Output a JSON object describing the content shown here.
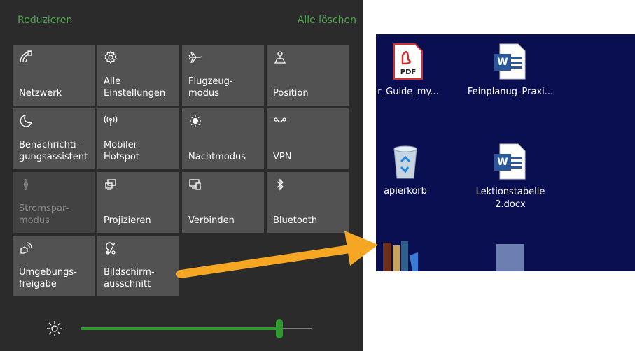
{
  "action_center": {
    "collapse_label": "Reduzieren",
    "clear_all_label": "Alle löschen",
    "tiles": [
      {
        "label": "Netzwerk",
        "icon": "network-icon",
        "active": true
      },
      {
        "label": "Alle\nEinstellungen",
        "icon": "gear-icon",
        "active": true
      },
      {
        "label": "Flugzeug-\nmodus",
        "icon": "airplane-icon",
        "active": true
      },
      {
        "label": "Position",
        "icon": "location-icon",
        "active": true
      },
      {
        "label": "Benachrichti-\ngungsassistent",
        "icon": "moon-icon",
        "active": true
      },
      {
        "label": "Mobiler\nHotspot",
        "icon": "hotspot-icon",
        "active": true
      },
      {
        "label": "Nachtmodus",
        "icon": "night-light-icon",
        "active": true
      },
      {
        "label": "VPN",
        "icon": "vpn-icon",
        "active": true
      },
      {
        "label": "Stromspar-\nmodus",
        "icon": "battery-saver-icon",
        "active": false
      },
      {
        "label": "Projizieren",
        "icon": "project-icon",
        "active": true
      },
      {
        "label": "Verbinden",
        "icon": "connect-icon",
        "active": true
      },
      {
        "label": "Bluetooth",
        "icon": "bluetooth-icon",
        "active": true
      },
      {
        "label": "Umgebungs-\nfreigabe",
        "icon": "nearby-sharing-icon",
        "active": true
      },
      {
        "label": "Bildschirm-\nausschnitt",
        "icon": "snip-icon",
        "active": true
      }
    ],
    "brightness": {
      "icon": "brightness-icon",
      "level": 0.86
    }
  },
  "desktop": {
    "icons": [
      {
        "name": "r_Guide_my...",
        "icon": "pdf-file-icon"
      },
      {
        "name": "Feinplanug_Praxi...",
        "icon": "word-file-icon"
      },
      {
        "name": "apierkorb",
        "icon": "recycle-bin-icon"
      },
      {
        "name": "Lektionstabelle\n2.docx",
        "icon": "word-file-icon"
      },
      {
        "name": "",
        "icon": "calibre-icon"
      },
      {
        "name": "",
        "icon": "blank-file-icon"
      }
    ],
    "pdf_badge": "PDF",
    "word_badge": "W"
  },
  "colors": {
    "panel_bg": "#2b2b2b",
    "tile_bg": "#525252",
    "tile_off_bg": "#424242",
    "accent_green": "#4ea64e",
    "desktop_bg": "#0a0f52",
    "arrow": "#f5a623"
  }
}
